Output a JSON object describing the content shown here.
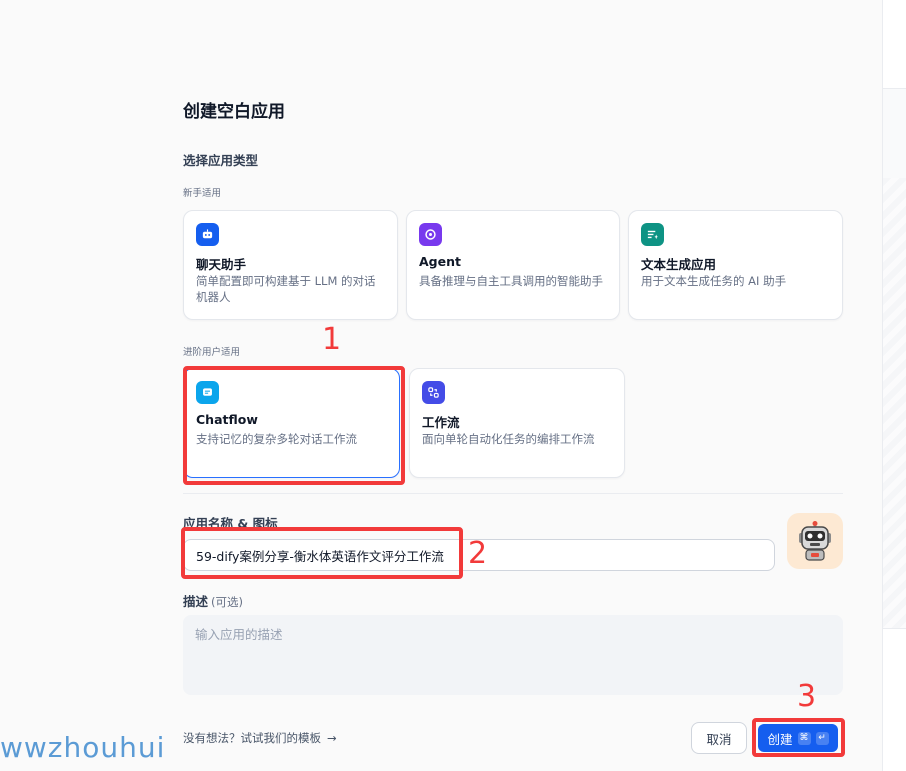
{
  "dialog": {
    "title": "创建空白应用",
    "type_section_label": "选择应用类型",
    "beginner_label": "新手适用",
    "advanced_label": "进阶用户适用"
  },
  "app_types": {
    "beginner": [
      {
        "name": "聊天助手",
        "desc": "简单配置即可构建基于 LLM 的对话机器人",
        "icon": "chat-bot-icon",
        "color": "#155eef"
      },
      {
        "name": "Agent",
        "desc": "具备推理与自主工具调用的智能助手",
        "icon": "agent-icon",
        "color": "#7839ee"
      },
      {
        "name": "文本生成应用",
        "desc": "用于文本生成任务的 AI 助手",
        "icon": "text-generation-icon",
        "color": "#0e9384"
      }
    ],
    "advanced": [
      {
        "name": "Chatflow",
        "desc": "支持记忆的复杂多轮对话工作流",
        "icon": "chatflow-icon",
        "color": "#0ba5ec",
        "selected": true
      },
      {
        "name": "工作流",
        "desc": "面向单轮自动化任务的编排工作流",
        "icon": "workflow-icon",
        "color": "#444ce7"
      }
    ]
  },
  "form": {
    "name_label": "应用名称 & 图标",
    "name_value": "59-dify案例分享-衡水体英语作文评分工作流",
    "avatar_icon": "robot-avatar-icon",
    "desc_label": "描述",
    "desc_optional": "(可选)",
    "desc_placeholder": "输入应用的描述"
  },
  "footer": {
    "template_link": "没有想法？试试我们的模板",
    "cancel_label": "取消",
    "create_label": "创建",
    "shortcut_cmd": "⌘",
    "shortcut_enter": "↵"
  },
  "annotations": {
    "step1": "1",
    "step2": "2",
    "step3": "3",
    "watermark": "wwzhouhui"
  },
  "colors": {
    "primary": "#155eef",
    "annotation_red": "#f23a3a",
    "selected_border": "#2970ff"
  }
}
